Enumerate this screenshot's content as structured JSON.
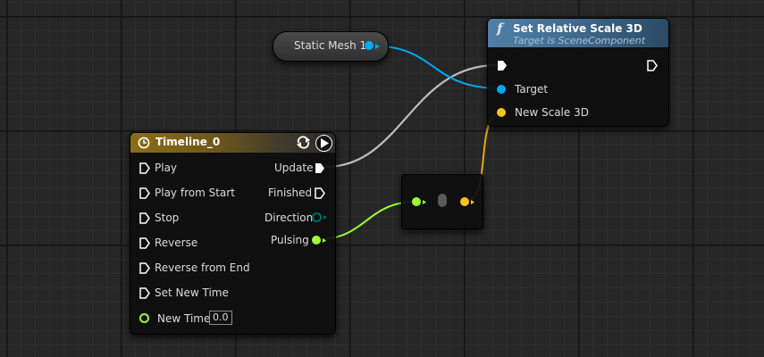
{
  "static_mesh_node": {
    "label": "Static Mesh 1"
  },
  "set_scale_node": {
    "icon": "f",
    "title": "Set Relative Scale 3D",
    "subtitle": "Target is SceneComponent",
    "pins": {
      "target": "Target",
      "new_scale": "New Scale 3D"
    }
  },
  "timeline_node": {
    "title": "Timeline_0",
    "inputs": [
      "Play",
      "Play from Start",
      "Stop",
      "Reverse",
      "Reverse from End",
      "Set New Time"
    ],
    "new_time_label": "New Time",
    "new_time_value": "0.0",
    "outputs": [
      "Update",
      "Finished",
      "Direction",
      "Pulsing"
    ]
  },
  "pin_colors": {
    "object": "#00a8f4",
    "vector": "#f6c21f",
    "float": "#9dff38",
    "exec": "#ffffff",
    "direction_enum": "#006b66"
  },
  "icons": [
    "function-icon",
    "clock-icon",
    "loop-icon",
    "play-icon"
  ]
}
